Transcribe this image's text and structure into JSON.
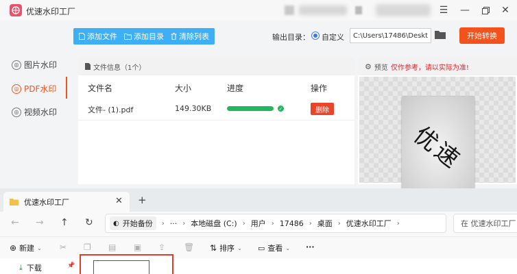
{
  "app": {
    "title": "优速水印工厂",
    "window_controls": [
      "menu-icon",
      "minimize-icon",
      "restore-icon",
      "close-icon"
    ],
    "toolbar": {
      "add_file": "添加文件",
      "add_folder": "添加目录",
      "clear_list": "清除列表",
      "output_label": "输出目录：",
      "custom_label": "自定义",
      "output_path": "C:\\Users\\17486\\Desktop",
      "start_button": "开始转换"
    },
    "sidebar": [
      {
        "label": "图片水印",
        "active": false
      },
      {
        "label": "PDF水印",
        "active": true
      },
      {
        "label": "视频水印",
        "active": false
      }
    ],
    "file_panel": {
      "header": "文件信息（1个）",
      "columns": [
        "文件名",
        "大小",
        "进度",
        "操作"
      ],
      "rows": [
        {
          "name": "文件- (1).pdf",
          "size": "149.30KB",
          "progress": 1.0,
          "action": "删除"
        }
      ]
    },
    "preview": {
      "label": "预览",
      "note": "仅作参考，请以实际为准!",
      "watermark_text": "优速"
    },
    "colors": {
      "accent_blue": "#3eaff5",
      "accent_orange": "#f4521c",
      "progress_green": "#20b85d",
      "delete_red": "#e8452b"
    }
  },
  "explorer": {
    "tab_title": "优速水印工厂",
    "address": {
      "backup": "开始备份",
      "crumbs": [
        "本地磁盘 (C:)",
        "用户",
        "17486",
        "桌面",
        "优速水印工厂"
      ]
    },
    "search_placeholder": "在 优速水印工厂 中搜索",
    "commands": {
      "new": "新建",
      "sort": "排序",
      "view": "查看"
    },
    "nav_item": "下载"
  }
}
